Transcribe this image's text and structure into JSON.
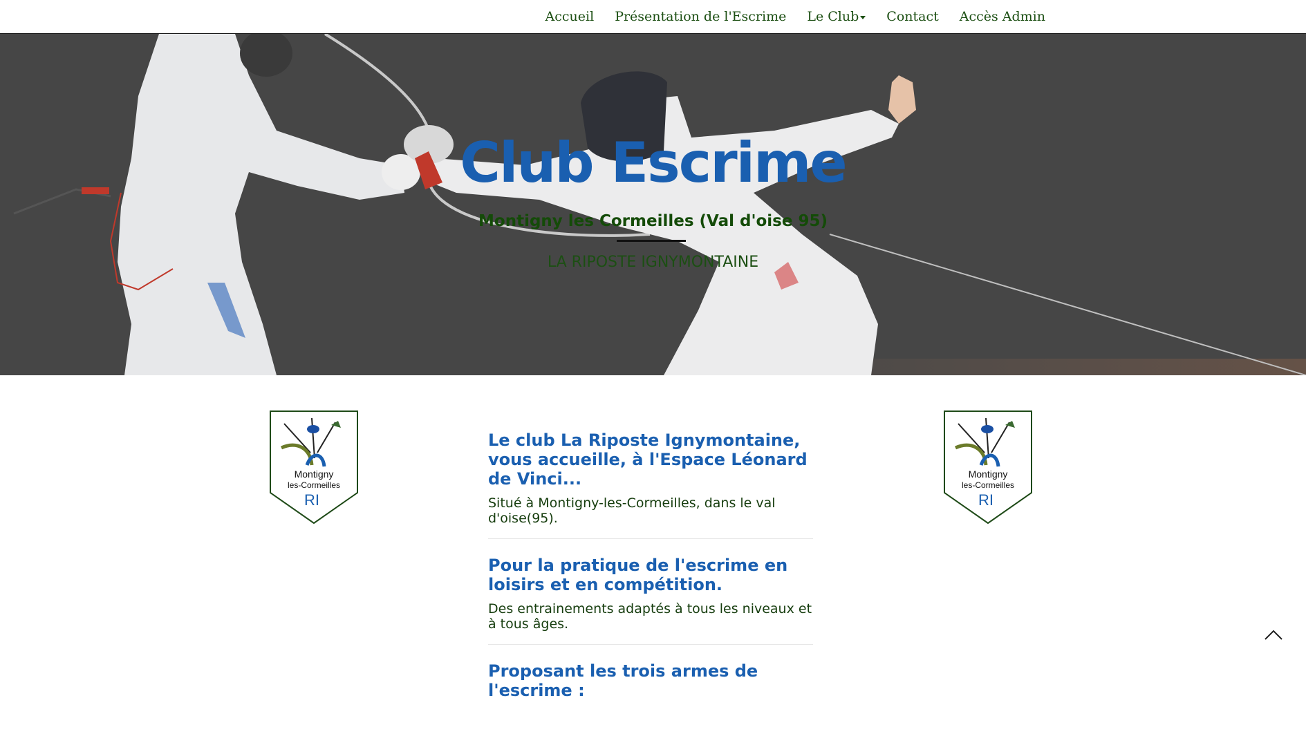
{
  "nav": {
    "items": [
      {
        "label": "Accueil"
      },
      {
        "label": "Présentation de l'Escrime"
      },
      {
        "label": "Le Club",
        "has_dropdown": true
      },
      {
        "label": "Contact"
      },
      {
        "label": "Accès Admin"
      }
    ]
  },
  "hero": {
    "title": "Club Escrime",
    "subtitle": "Montigny les Cormeilles (Val d'oise 95)",
    "tagline": "LA RIPOSTE IGNYMONTAINE"
  },
  "logo": {
    "line1": "Montigny",
    "line2": "les-Cormeilles",
    "initials": "RI"
  },
  "features": [
    {
      "title": "Le club La Riposte Ignymontaine, vous accueille, à l'Espace Léonard de Vinci...",
      "text": "Situé à Montigny-les-Cormeilles, dans le val d'oise(95)."
    },
    {
      "title": "Pour la pratique de l'escrime en loisirs et en compétition.",
      "text": "Des entrainements adaptés à tous les niveaux et à tous âges."
    },
    {
      "title": "Proposant les trois armes de l'escrime :",
      "text": ""
    }
  ],
  "colors": {
    "nav_text": "#1c4f13",
    "title_blue": "#1a5fb0",
    "subtitle_green": "#144b08",
    "hero_bg": "#454545"
  }
}
